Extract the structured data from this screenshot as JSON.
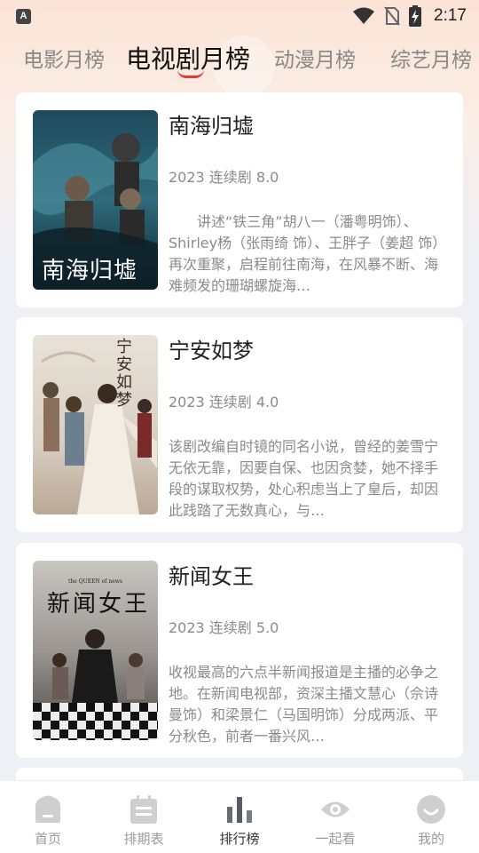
{
  "status_bar": {
    "time": "2:17",
    "app_badge": "A",
    "icons": [
      "wifi-icon",
      "no-sim-icon",
      "battery-charging-icon"
    ]
  },
  "tabs": [
    {
      "label": "电影月榜",
      "active": false
    },
    {
      "label": "电视剧月榜",
      "active": true
    },
    {
      "label": "动漫月榜",
      "active": false
    },
    {
      "label": "综艺月榜",
      "active": false
    }
  ],
  "accent_color": "#e2393b",
  "items": [
    {
      "title": "南海归墟",
      "meta": "2023 连续剧 8.0",
      "description": "　　讲述“铁三角”胡八一（潘粤明饰）、Shirley杨（张雨绮 饰）、王胖子（姜超 饰）再次重聚，启程前往南海，在风暴不断、海难频发的珊瑚螺旋海…",
      "poster_text": "南海归墟"
    },
    {
      "title": "宁安如梦",
      "meta": "2023 连续剧 4.0",
      "description": "该剧改编自时镜的同名小说，曾经的姜雪宁无依无靠，因要自保、也因贪婪，她不择手段的谋取权势，处心积虑当上了皇后，却因此践踏了无数真心，与…",
      "poster_text": "宁安如梦"
    },
    {
      "title": "新闻女王",
      "meta": "2023 连续剧 5.0",
      "description": "收视最高的六点半新闻报道是主播的必争之地。在新闻电视部，资深主播文慧心（佘诗曼饰）和梁景仁（马国明饰）分成两派、平分秋色，前者一番兴风…",
      "poster_text": "新闻女王",
      "poster_subtext": "the QUEEN of news"
    }
  ],
  "bottom_nav": [
    {
      "label": "首页",
      "icon": "home-icon",
      "active": false
    },
    {
      "label": "排期表",
      "icon": "calendar-icon",
      "active": false
    },
    {
      "label": "排行榜",
      "icon": "bar-chart-icon",
      "active": true
    },
    {
      "label": "一起看",
      "icon": "eye-icon",
      "active": false
    },
    {
      "label": "我的",
      "icon": "smile-icon",
      "active": false
    }
  ]
}
